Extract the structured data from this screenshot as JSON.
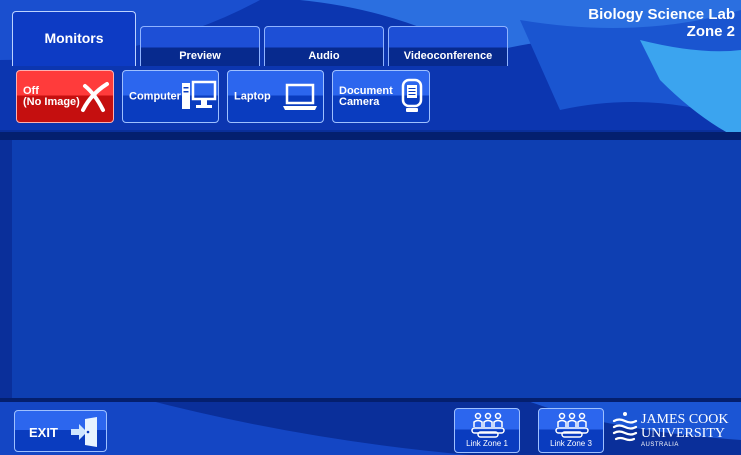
{
  "title": {
    "line1": "Biology Science Lab",
    "line2": "Zone 2"
  },
  "tabs": [
    {
      "label": "Monitors",
      "active": true
    },
    {
      "label": "Preview"
    },
    {
      "label": "Audio"
    },
    {
      "label": "Videoconference"
    }
  ],
  "sources": [
    {
      "label": "Off\n(No Image)",
      "icon": "close-x-icon"
    },
    {
      "label": "Computer",
      "icon": "desktop-computer-icon"
    },
    {
      "label": "Laptop",
      "icon": "laptop-icon"
    },
    {
      "label": "Document\nCamera",
      "icon": "document-camera-icon"
    }
  ],
  "footer": {
    "exit_label": "EXIT",
    "link_zone_1": "Link Zone 1",
    "link_zone_3": "Link Zone 3",
    "logo": {
      "line1": "JAMES COOK",
      "line2": "UNIVERSITY",
      "line3": "AUSTRALIA"
    }
  },
  "colors": {
    "accent": "#1d4fd6",
    "off_red": "#d81414",
    "background": "#0a2f9a"
  }
}
